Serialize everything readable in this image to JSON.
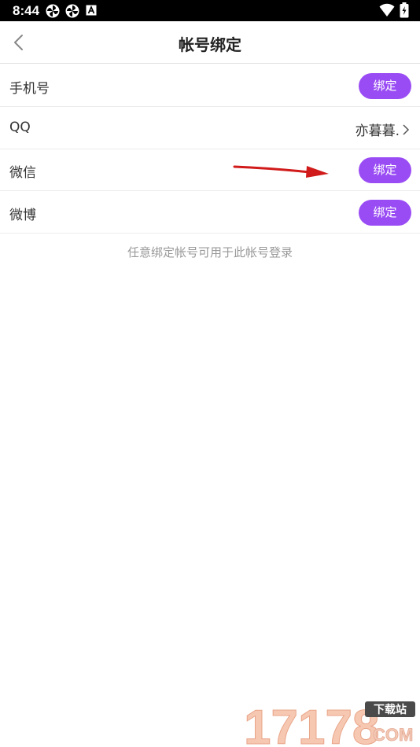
{
  "status_bar": {
    "time": "8:44",
    "icons": [
      "pinwheel-icon",
      "pinwheel-icon",
      "font-a-icon",
      "wifi-icon",
      "battery-charging-icon"
    ]
  },
  "nav": {
    "title": "帐号绑定",
    "back_icon": "chevron-left-icon"
  },
  "accounts": [
    {
      "label": "手机号",
      "action": "绑定"
    },
    {
      "label": "QQ",
      "value": "亦暮暮."
    },
    {
      "label": "微信",
      "action": "绑定"
    },
    {
      "label": "微博",
      "action": "绑定"
    }
  ],
  "hint": "任意绑定帐号可用于此帐号登录",
  "colors": {
    "accent": "#9a4cf4",
    "arrow": "#d11a1a",
    "hint_text": "#999999"
  },
  "watermark": {
    "number": "17178",
    "badge": "下载站",
    "suffix": "COM"
  }
}
